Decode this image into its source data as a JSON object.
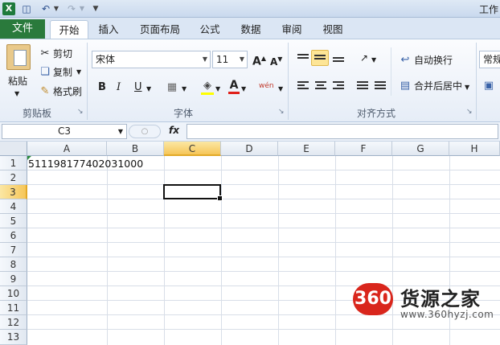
{
  "window": {
    "title": "工作"
  },
  "tabs": [
    "文件",
    "开始",
    "插入",
    "页面布局",
    "公式",
    "数据",
    "审阅",
    "视图"
  ],
  "clipboard": {
    "paste": "粘贴",
    "cut": "剪切",
    "copy": "复制",
    "format_painter": "格式刷",
    "label": "剪贴板"
  },
  "font": {
    "name": "宋体",
    "size": "11",
    "bold": "B",
    "italic": "I",
    "underline": "U",
    "grow": "A",
    "shrink": "A",
    "label": "字体",
    "font_color": "A",
    "phonetic": "wén"
  },
  "alignment": {
    "wrap": "自动换行",
    "merge": "合并后居中",
    "label": "对齐方式"
  },
  "number": {
    "format": "常规"
  },
  "formula_bar": {
    "name_box": "C3",
    "fx": "fx",
    "value": ""
  },
  "grid": {
    "columns": [
      "A",
      "B",
      "C",
      "D",
      "E",
      "F",
      "G",
      "H"
    ],
    "rows": [
      "1",
      "2",
      "3",
      "4",
      "5",
      "6",
      "7",
      "8",
      "9",
      "10",
      "11",
      "12",
      "13"
    ],
    "a1_value": "511198177402031000",
    "active_cell": "C3"
  },
  "watermark": {
    "badge": "360",
    "name": "货源之家",
    "url": "www.360hyzj.com"
  }
}
